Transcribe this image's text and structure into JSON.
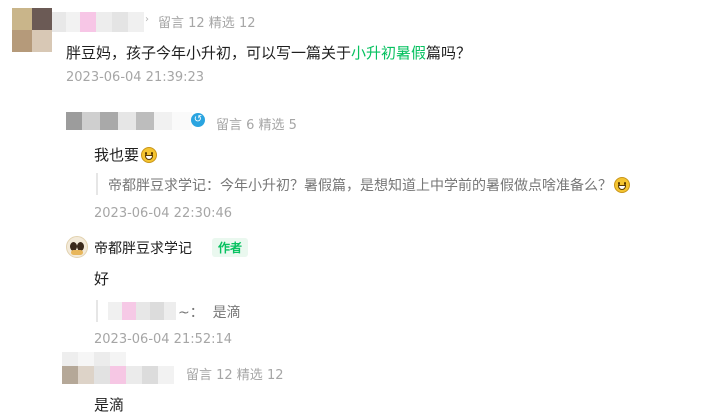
{
  "comments": [
    {
      "meta": "留言 12 精选 12",
      "text_before": "胖豆妈，孩子今年小升初，可以写一篇关于",
      "text_highlight": "小升初暑假",
      "text_after": "篇吗？",
      "time": "2023-06-04 21:39:23",
      "replies": [
        {
          "meta": "留言 6 精选 5",
          "text": "我也要",
          "quote": "帝都胖豆求学记：今年小升初？暑假篇，是想知道上中学前的暑假做点啥准备么？",
          "time": "2023-06-04 22:30:46"
        },
        {
          "name": "帝都胖豆求学记",
          "badge": "作者",
          "text": "好",
          "quote_suffix": "~：  是滴",
          "time": "2023-06-04 21:52:14"
        }
      ]
    },
    {
      "meta": "留言 12 精选 12",
      "text": "是滴"
    }
  ]
}
